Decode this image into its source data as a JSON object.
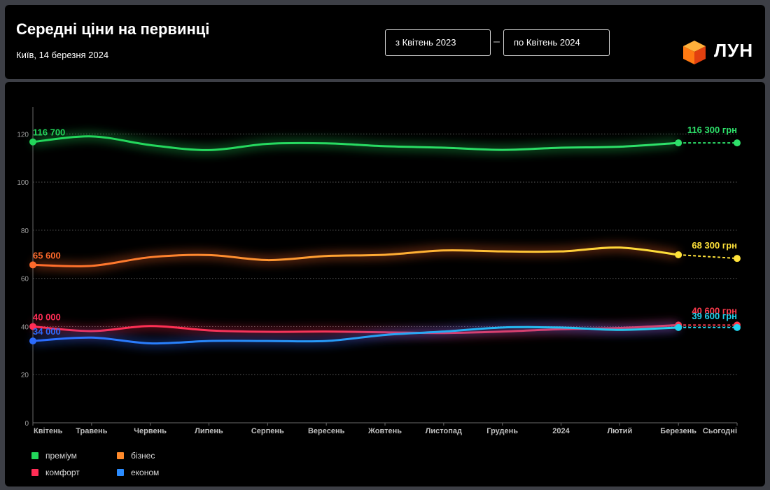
{
  "header": {
    "title": "Середні ціни на первинці",
    "subtitle": "Київ, 14 березня 2024",
    "date_from": "з Квітень 2023",
    "date_separator": "–",
    "date_to": "по Квітень 2024",
    "logo_text": "ЛУН",
    "logo_color": "#ff6a13"
  },
  "legend": {
    "items": [
      {
        "label": "преміум",
        "color": "#22d65a"
      },
      {
        "label": "бізнес",
        "color": "#ff8a2b"
      },
      {
        "label": "комфорт",
        "color": "#ff2d55"
      },
      {
        "label": "економ",
        "color": "#2b8cff"
      }
    ]
  },
  "chart_data": {
    "type": "line",
    "categories": [
      "Квітень",
      "Травень",
      "Червень",
      "Липень",
      "Серпень",
      "Вересень",
      "Жовтень",
      "Листопад",
      "Грудень",
      "2024",
      "Лютий",
      "Березень",
      "Сьогодні"
    ],
    "ylim": [
      0,
      130
    ],
    "yticks": [
      "0",
      "20",
      "40",
      "60",
      "80",
      "100",
      "120"
    ],
    "grid": true,
    "series": [
      {
        "name": "преміум",
        "color": "#22d65a",
        "end_color": "#2ee06a",
        "values": [
          116.7,
          119.0,
          115.4,
          113.3,
          115.9,
          116.1,
          114.9,
          114.3,
          113.4,
          114.3,
          114.7,
          116.3,
          116.3
        ],
        "start_label": "116 700",
        "end_label": "116 300 грн"
      },
      {
        "name": "бізнес",
        "color": "#ff6a2b",
        "end_color": "#ffe23a",
        "values": [
          65.6,
          65.2,
          68.8,
          69.7,
          67.6,
          69.3,
          69.8,
          71.6,
          71.2,
          71.2,
          72.8,
          69.8,
          68.3
        ],
        "start_label": "65 600",
        "end_label": "68 300 грн"
      },
      {
        "name": "комфорт",
        "color": "#ff2d55",
        "end_color": "#ff3b4d",
        "values": [
          40.0,
          38.1,
          40.2,
          38.4,
          37.8,
          37.9,
          37.6,
          37.3,
          37.9,
          38.9,
          39.4,
          40.6,
          40.6
        ],
        "start_label": "40 000",
        "end_label": "40 600 грн"
      },
      {
        "name": "економ",
        "color": "#2b6bff",
        "end_color": "#22d3ee",
        "values": [
          34.0,
          35.4,
          33.0,
          34.0,
          34.0,
          34.0,
          36.5,
          37.9,
          39.6,
          39.6,
          38.6,
          39.6,
          39.6
        ],
        "start_label": "34 000",
        "end_label": "39 600 грн"
      }
    ]
  }
}
